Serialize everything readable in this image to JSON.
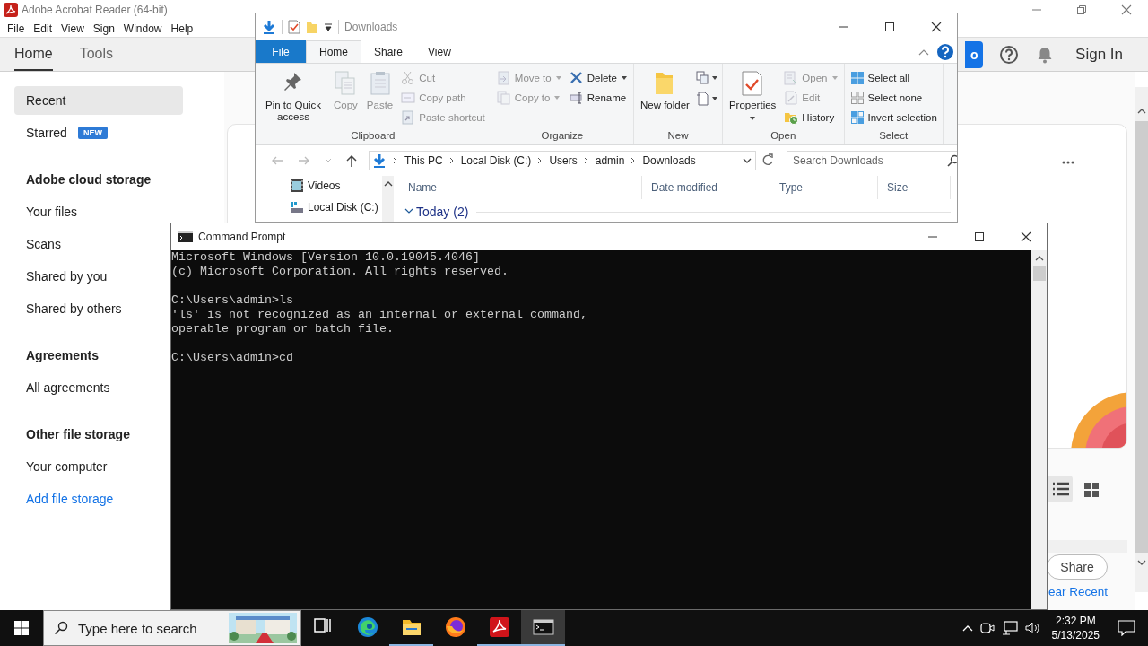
{
  "acrobat": {
    "title": "Adobe Acrobat Reader (64-bit)",
    "menu": [
      "File",
      "Edit",
      "View",
      "Sign",
      "Window",
      "Help"
    ],
    "tabs": [
      {
        "label": "Home",
        "selected": true
      },
      {
        "label": "Tools",
        "selected": false
      }
    ],
    "header_button": "o",
    "sign_in": "Sign In",
    "sidebar": [
      {
        "kind": "item",
        "label": "Recent",
        "selected": true
      },
      {
        "kind": "item",
        "label": "Starred",
        "badge": "NEW",
        "selected": false
      },
      {
        "kind": "heading",
        "label": "Adobe cloud storage"
      },
      {
        "kind": "item",
        "label": "Your files",
        "selected": false
      },
      {
        "kind": "item",
        "label": "Scans",
        "selected": false
      },
      {
        "kind": "item",
        "label": "Shared by you",
        "selected": false
      },
      {
        "kind": "item",
        "label": "Shared by others",
        "selected": false
      },
      {
        "kind": "heading",
        "label": "Agreements"
      },
      {
        "kind": "item",
        "label": "All agreements",
        "selected": false
      },
      {
        "kind": "heading",
        "label": "Other file storage"
      },
      {
        "kind": "item",
        "label": "Your computer",
        "selected": false
      },
      {
        "kind": "link",
        "label": "Add file storage"
      }
    ],
    "view_modes": [
      {
        "kind": "list",
        "selected": true
      },
      {
        "kind": "grid",
        "selected": false
      }
    ],
    "share_button": "Share",
    "clear_link": "ear Recent"
  },
  "explorer": {
    "title": "Downloads",
    "ribbon_tabs": [
      {
        "kind": "file",
        "label": "File",
        "selected": false
      },
      {
        "kind": "tab",
        "label": "Home",
        "selected": true
      },
      {
        "kind": "tab",
        "label": "Share",
        "selected": false
      },
      {
        "kind": "tab",
        "label": "View",
        "selected": false
      }
    ],
    "groups": [
      {
        "label": "Clipboard",
        "columns": [
          [
            {
              "kind": "large",
              "label": "Pin to Quick access",
              "disabled": false
            }
          ],
          [
            {
              "kind": "large",
              "label": "Copy",
              "disabled": true
            }
          ],
          [
            {
              "kind": "large",
              "label": "Paste",
              "disabled": true
            }
          ],
          [
            {
              "kind": "small",
              "label": "Cut",
              "disabled": true
            },
            {
              "kind": "small",
              "label": "Copy path",
              "disabled": true
            },
            {
              "kind": "small",
              "label": "Paste shortcut",
              "disabled": true
            }
          ]
        ]
      },
      {
        "label": "Organize",
        "columns": [
          [
            {
              "kind": "small",
              "label": "Move to",
              "disabled": true,
              "menu": true
            },
            {
              "kind": "small",
              "label": "Copy to",
              "disabled": true,
              "menu": true
            }
          ],
          [
            {
              "kind": "small",
              "label": "Delete",
              "disabled": false,
              "menu": true
            },
            {
              "kind": "small",
              "label": "Rename",
              "disabled": false
            }
          ]
        ]
      },
      {
        "label": "New",
        "columns": [
          [
            {
              "kind": "large",
              "label": "New folder",
              "disabled": false
            }
          ],
          [
            {
              "kind": "icon",
              "disabled": false,
              "menu": true
            },
            {
              "kind": "icon",
              "disabled": false,
              "menu": true
            }
          ]
        ]
      },
      {
        "label": "Open",
        "columns": [
          [
            {
              "kind": "large",
              "label": "Properties",
              "disabled": false,
              "menu": true
            }
          ],
          [
            {
              "kind": "small",
              "label": "Open",
              "disabled": true,
              "menu": true
            },
            {
              "kind": "small",
              "label": "Edit",
              "disabled": true
            },
            {
              "kind": "small",
              "label": "History",
              "disabled": false
            }
          ]
        ]
      },
      {
        "label": "Select",
        "columns": [
          [
            {
              "kind": "small",
              "label": "Select all",
              "disabled": false
            },
            {
              "kind": "small",
              "label": "Select none",
              "disabled": false
            },
            {
              "kind": "small",
              "label": "Invert selection",
              "disabled": false
            }
          ]
        ]
      }
    ],
    "breadcrumb": [
      "This PC",
      "Local Disk (C:)",
      "Users",
      "admin",
      "Downloads"
    ],
    "search": {
      "placeholder": "Search Downloads"
    },
    "nav": [
      "Videos",
      "Local Disk (C:)"
    ],
    "columns": [
      "Name",
      "Date modified",
      "Type",
      "Size"
    ],
    "group_header": "Today (2)"
  },
  "cmd": {
    "title": "Command Prompt",
    "blocks": [
      [
        "Microsoft Windows [Version 10.0.19045.4046]",
        "(c) Microsoft Corporation. All rights reserved."
      ],
      [
        "C:\\Users\\admin>ls",
        "'ls' is not recognized as an internal or external command,",
        "operable program or batch file."
      ],
      [
        "C:\\Users\\admin>cd"
      ]
    ]
  },
  "taskbar": {
    "search": {
      "placeholder": "Type here to search"
    },
    "apps": [
      {
        "kind": "task-view",
        "selected": false,
        "running": false
      },
      {
        "kind": "edge",
        "selected": false,
        "running": false
      },
      {
        "kind": "explorer",
        "selected": false,
        "running": true
      },
      {
        "kind": "firefox",
        "selected": false,
        "running": false
      },
      {
        "kind": "acrobat",
        "selected": false,
        "running": true
      },
      {
        "kind": "terminal",
        "selected": true,
        "running": true
      }
    ],
    "time": "2:32 PM",
    "date": "5/13/2025"
  }
}
